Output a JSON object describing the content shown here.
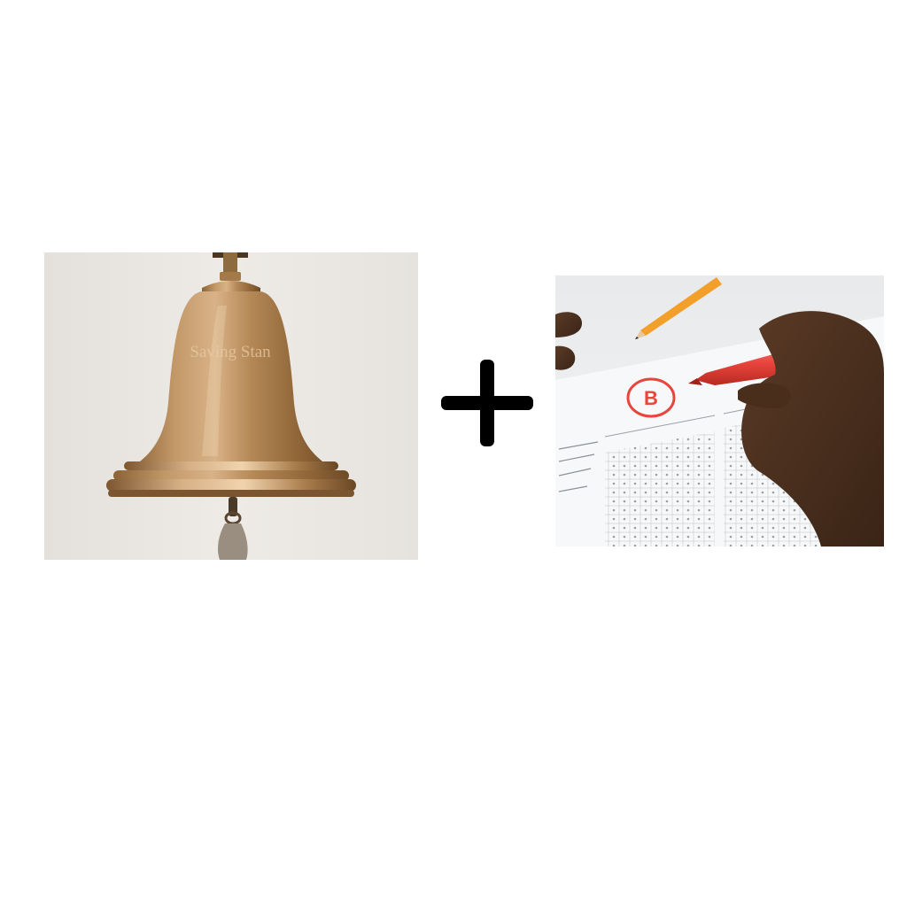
{
  "bell_panel": {
    "engraving": "Saving Stan",
    "icon": "brass-bell"
  },
  "operator": {
    "symbol": "+",
    "icon": "plus-sign"
  },
  "test_panel": {
    "grade": "B",
    "icon": "graded-answer-sheet"
  },
  "colors": {
    "background": "#ffffff",
    "brass": "#b88a55",
    "operator": "#000000",
    "pen_red": "#e8453c"
  }
}
